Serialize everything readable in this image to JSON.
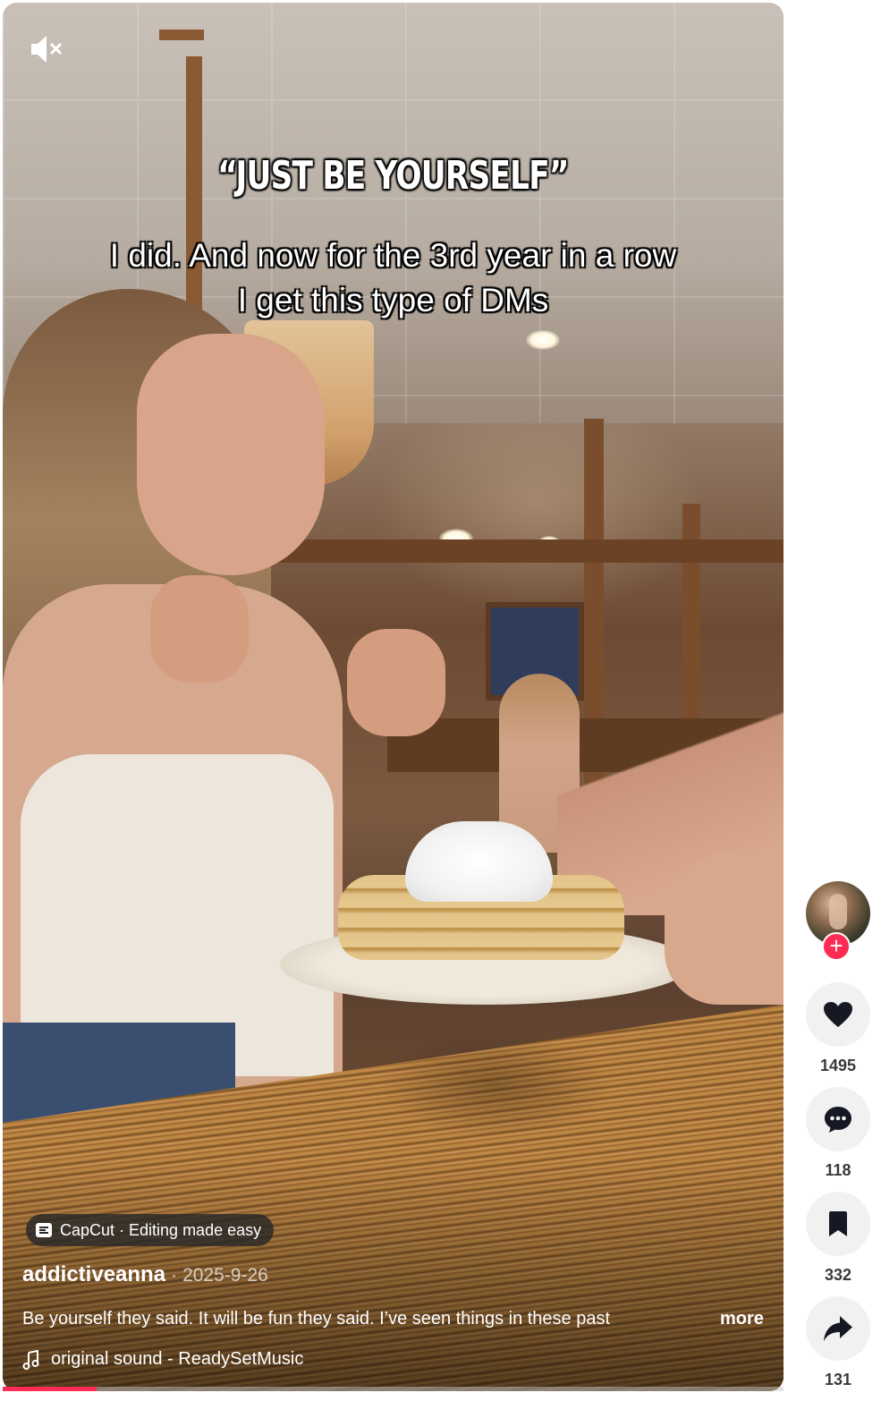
{
  "video": {
    "headline": "“JUST BE YOURSELF”",
    "caption_line1": "I did. And now for the 3rd year in a row",
    "caption_line2": "I get this type of DMs",
    "capcut_label": "CapCut · Editing made easy",
    "author": "addictiveanna",
    "separator": "·",
    "date": "2025-9-26",
    "description": "Be yourself they said. It will be fun they said.    I’ve seen things in these past",
    "more_label": "more",
    "sound": "original sound - ReadySetMusic",
    "progress_fraction": 0.12
  },
  "actions": {
    "likes": "1495",
    "comments": "118",
    "saves": "332",
    "shares": "131"
  },
  "icons": {
    "mute": "speaker-muted-icon",
    "capcut": "capcut-logo-icon",
    "music": "music-note-icon",
    "follow": "plus-icon",
    "like": "heart-icon",
    "comment": "comment-bubble-icon",
    "save": "bookmark-icon",
    "share": "share-arrow-icon"
  },
  "colors": {
    "accent": "#fe2c55",
    "action_bg": "#f1f1f2",
    "icon": "#161823"
  }
}
